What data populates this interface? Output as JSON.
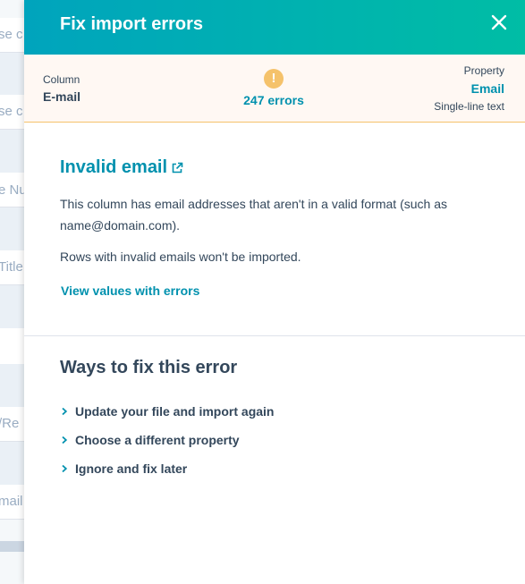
{
  "background": {
    "fragments": [
      "se c",
      "se c",
      "e Nu",
      "Title",
      "/Re",
      "mail"
    ]
  },
  "panel": {
    "title": "Fix import errors",
    "close_label": "×"
  },
  "summary": {
    "column_label": "Column",
    "column_value": "E-mail",
    "warning_symbol": "!",
    "error_count": "247 errors",
    "property_label": "Property",
    "property_value": "Email",
    "property_type": "Single-line text"
  },
  "error": {
    "title": "Invalid email",
    "description": "This column has email addresses that aren't in a valid format (such as name@domain.com).",
    "note": "Rows with invalid emails won't be imported.",
    "view_link": "View values with errors"
  },
  "fixes": {
    "title": "Ways to fix this error",
    "items": [
      "Update your file and import again",
      "Choose a different property",
      "Ignore and fix later"
    ]
  },
  "colors": {
    "header_start": "#00a4bd",
    "header_end": "#00bda5",
    "link": "#0091ae",
    "warning": "#f5c26b",
    "text": "#33475b"
  }
}
